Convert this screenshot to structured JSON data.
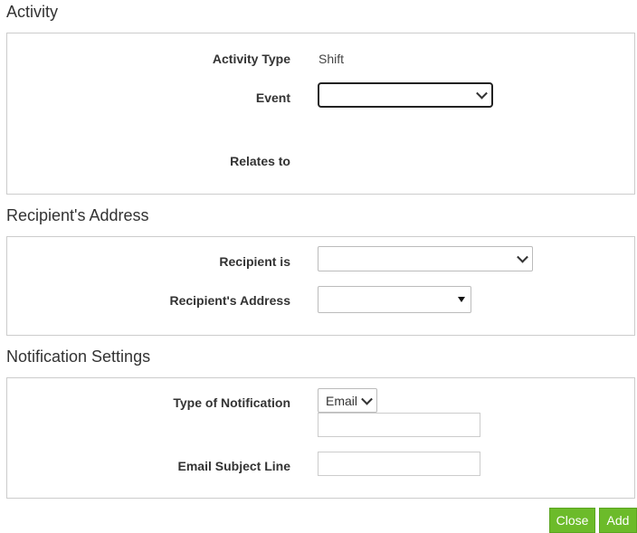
{
  "sections": {
    "activity": {
      "title": "Activity",
      "activity_type_label": "Activity Type",
      "activity_type_value": "Shift",
      "event_label": "Event",
      "event_value": "",
      "relates_to_label": "Relates to"
    },
    "recipient": {
      "title": "Recipient's Address",
      "recipient_is_label": "Recipient is",
      "recipient_is_value": "",
      "recipient_address_label": "Recipient's Address",
      "recipient_address_value": ""
    },
    "notification": {
      "title": "Notification Settings",
      "type_label": "Type of Notification",
      "type_value": "Email",
      "type_extra_value": "",
      "subject_label": "Email Subject Line",
      "subject_value": ""
    }
  },
  "buttons": {
    "close": "Close",
    "add": "Add"
  },
  "colors": {
    "button_bg": "#6cbb2a",
    "border": "#cccccc"
  },
  "icons": {
    "select_arrow": "chevron-down-icon",
    "dropdown_caret": "caret-down-icon"
  }
}
